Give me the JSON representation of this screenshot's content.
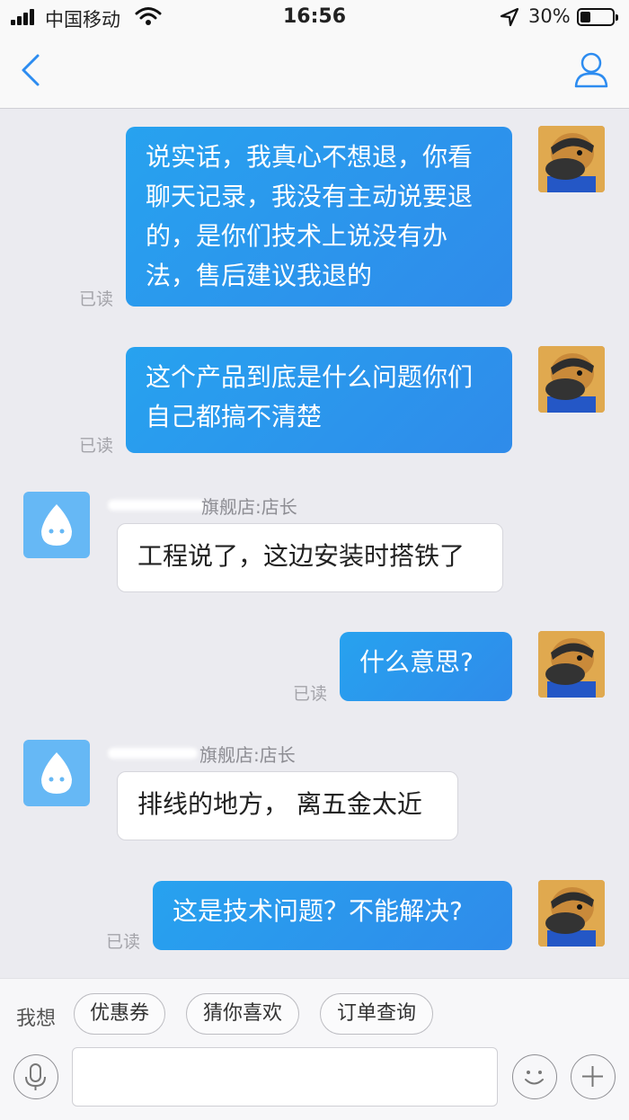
{
  "status_bar": {
    "carrier": "中国移动",
    "time": "16:56",
    "battery_percent": "30%",
    "battery_level": 0.3,
    "icons": [
      "signal-icon",
      "wifi-icon",
      "location-arrow-icon",
      "battery-icon"
    ]
  },
  "nav": {
    "title": "",
    "icons": [
      "back-chevron-icon",
      "profile-icon"
    ]
  },
  "messages": [
    {
      "side": "out",
      "text": "说实话，我真心不想退，你看聊天记录，我没有主动说要退的，是你们技术上说没有办法，售后建议我退的",
      "status": "已读"
    },
    {
      "side": "out",
      "text": "这个产品到底是什么问题你们自己都搞不清楚",
      "status": "已读"
    },
    {
      "side": "in",
      "sender": "旗舰店:店长",
      "text": "工程说了，这边安装时搭铁了"
    },
    {
      "side": "out",
      "text": "什么意思?",
      "status": "已读"
    },
    {
      "side": "in",
      "sender": "旗舰店:店长",
      "text": "排线的地方， 离五金太近"
    },
    {
      "side": "out",
      "text": "这是技术问题？不能解决?",
      "status": "已读"
    }
  ],
  "quick_bar": {
    "label": "我想",
    "chips": [
      "优惠券",
      "猜你喜欢",
      "订单查询"
    ]
  },
  "input_bar": {
    "placeholder": "",
    "icons": [
      "microphone-icon",
      "emoji-icon",
      "plus-icon"
    ]
  },
  "colors": {
    "outgoing_bubble": "#2b96ec",
    "background": "#ebebf0",
    "accent": "#2d8cf0"
  }
}
